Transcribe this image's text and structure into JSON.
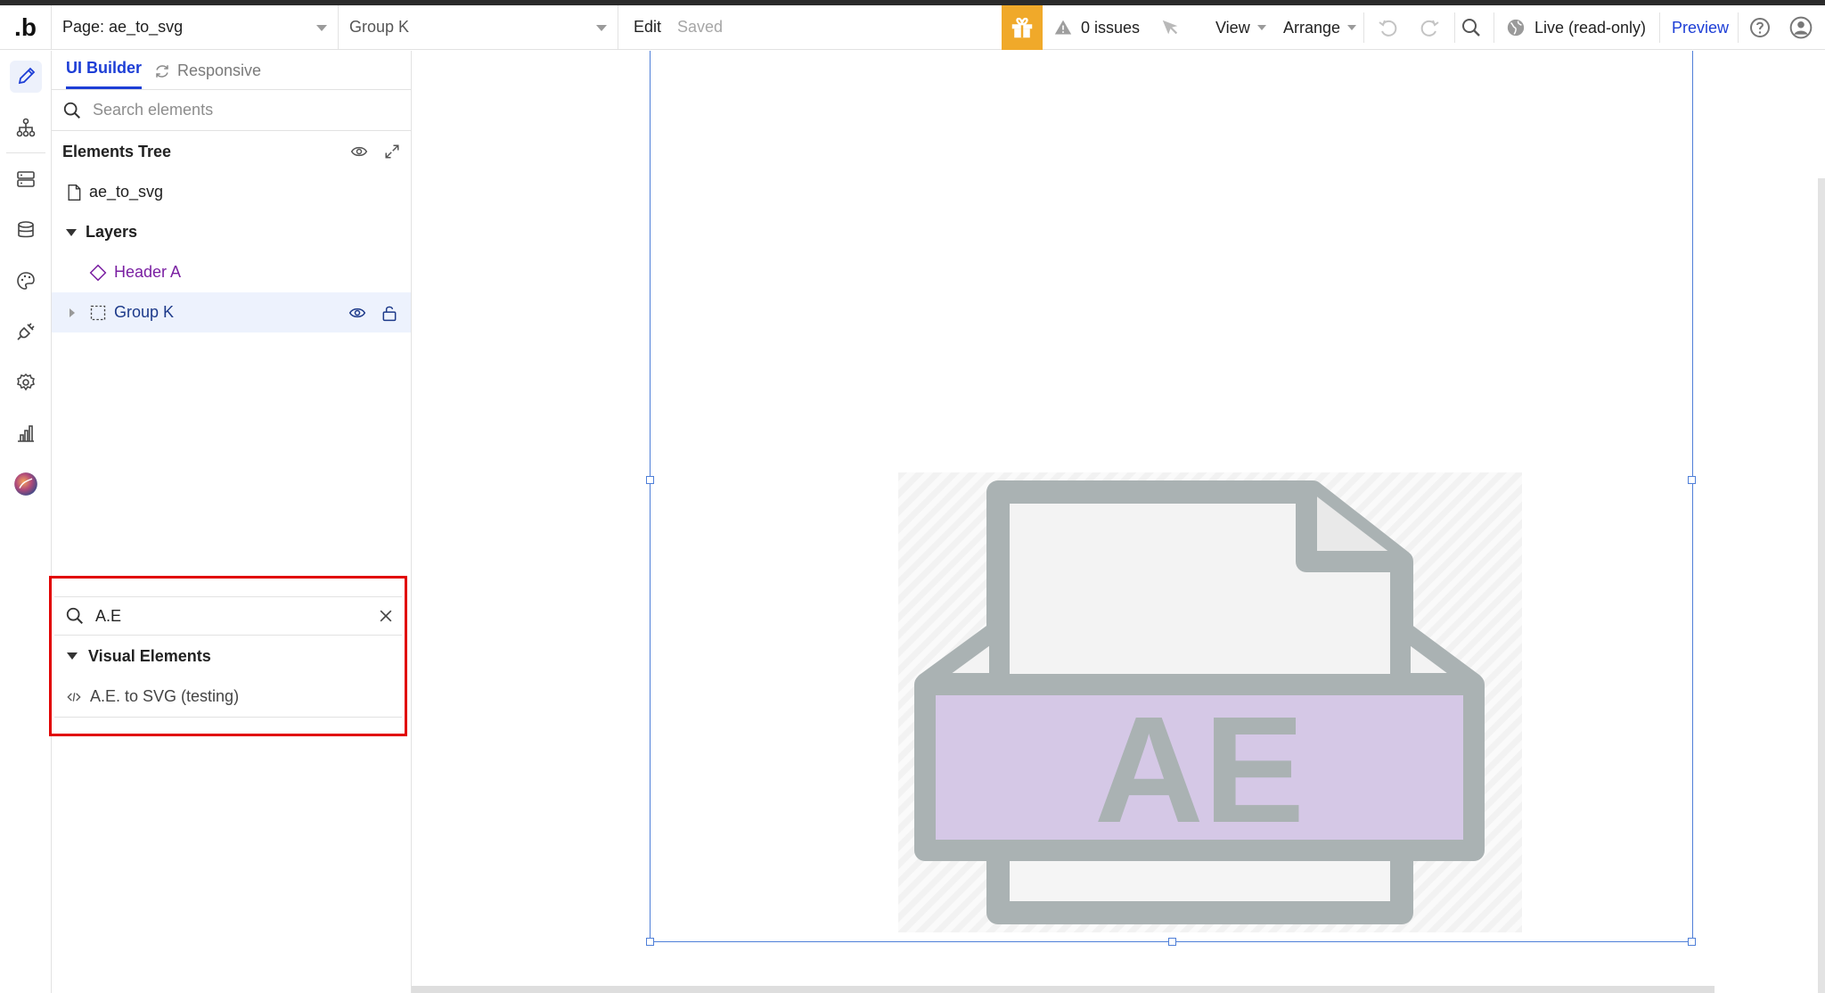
{
  "topbar": {
    "logo": ".b",
    "page_label": "Page: ae_to_svg",
    "element_selector": "Group K",
    "edit_label": "Edit",
    "saved_label": "Saved",
    "issues_label": "0 issues",
    "view_label": "View",
    "arrange_label": "Arrange",
    "live_label": "Live (read-only)",
    "preview_label": "Preview"
  },
  "panel": {
    "tabs": [
      {
        "label": "UI Builder"
      },
      {
        "label": "Responsive"
      }
    ],
    "search_placeholder": "Search elements",
    "tree_title": "Elements Tree",
    "tree": {
      "page": "ae_to_svg",
      "layers_label": "Layers",
      "items": [
        {
          "label": "Header A"
        },
        {
          "label": "Group K"
        }
      ]
    }
  },
  "element_search": {
    "query": "A.E",
    "category": "Visual Elements",
    "result": "A.E. to SVG (testing)"
  },
  "canvas": {
    "file_icon_text": "AE"
  },
  "colors": {
    "accent_blue": "#1d3ed6",
    "gift_orange": "#f0a92a",
    "highlight_red": "#e10000",
    "ae_purple": "#d5c8e6",
    "file_gray": "#a9b1b3"
  }
}
